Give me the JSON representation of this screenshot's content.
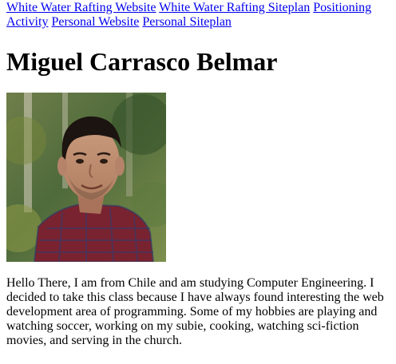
{
  "nav": {
    "links": [
      "White Water Rafting Website",
      "White Water Rafting Siteplan",
      "Positioning Activity",
      "Personal Website",
      "Personal Siteplan"
    ]
  },
  "header": {
    "title": "Miguel Carrasco Belmar"
  },
  "main": {
    "bio": "Hello There, I am from Chile and am studying Computer Engineering. I decided to take this class because I have always found interesting the web development area of programming. Some of my hobbies are playing and watching soccer, working on my subie, cooking, watching sci-fiction movies, and serving in the church."
  }
}
